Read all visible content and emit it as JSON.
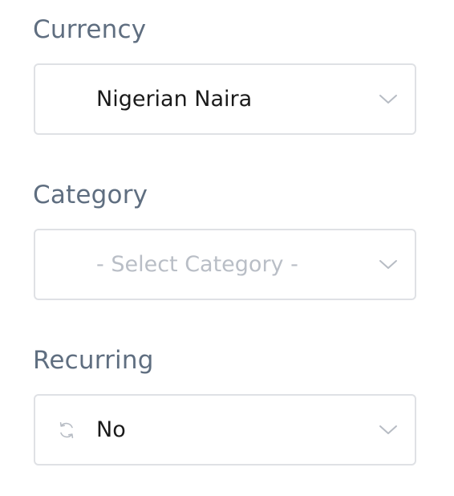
{
  "currency": {
    "label": "Currency",
    "value": "Nigerian Naira",
    "chevron_icon": "chevron-down-icon"
  },
  "category": {
    "label": "Category",
    "placeholder": "- Select Category -",
    "chevron_icon": "chevron-down-icon"
  },
  "recurring": {
    "label": "Recurring",
    "value": "No",
    "icon": "repeat-icon",
    "chevron_icon": "chevron-down-icon"
  },
  "colors": {
    "label_text": "#5f6e80",
    "border": "#dfe1e5",
    "value_text": "#1a1a1a",
    "placeholder_text": "#b9bec6",
    "chevron": "#b7bcc4"
  }
}
